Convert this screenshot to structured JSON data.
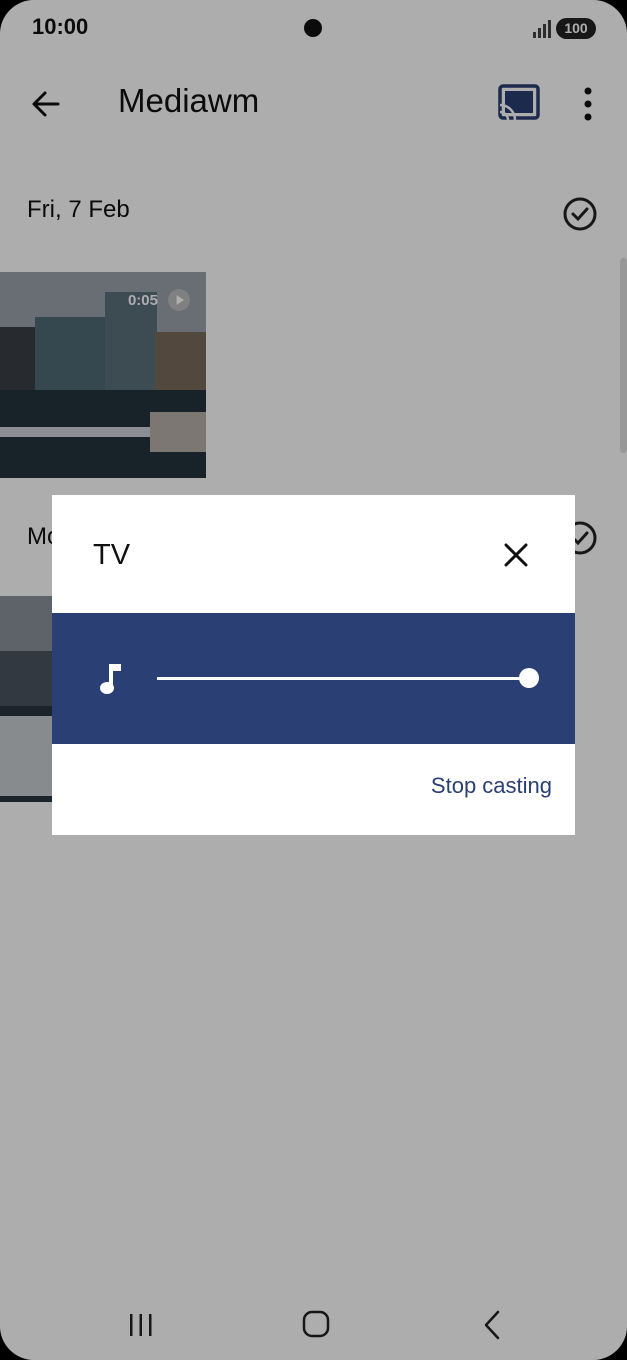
{
  "status_bar": {
    "time": "10:00",
    "battery": "100"
  },
  "app_bar": {
    "title": "Mediawm",
    "back_icon": "arrow-back-icon",
    "cast_icon": "cast-connected-icon",
    "more_icon": "more-vert-icon"
  },
  "sections": [
    {
      "date": "Fri, 7 Feb",
      "video_duration": "0:05"
    },
    {
      "date": "Mo"
    }
  ],
  "dialog": {
    "title": "TV",
    "close_icon": "close-icon",
    "volume_icon": "music-note-icon",
    "volume_level": 1.0,
    "stop_label": "Stop casting"
  },
  "nav_bar": {
    "recent_icon": "recent-apps-icon",
    "home_icon": "home-icon",
    "back_icon": "nav-back-icon"
  },
  "colors": {
    "accent": "#2a3f73",
    "scrim": "rgba(0,0,0,0.32)"
  }
}
